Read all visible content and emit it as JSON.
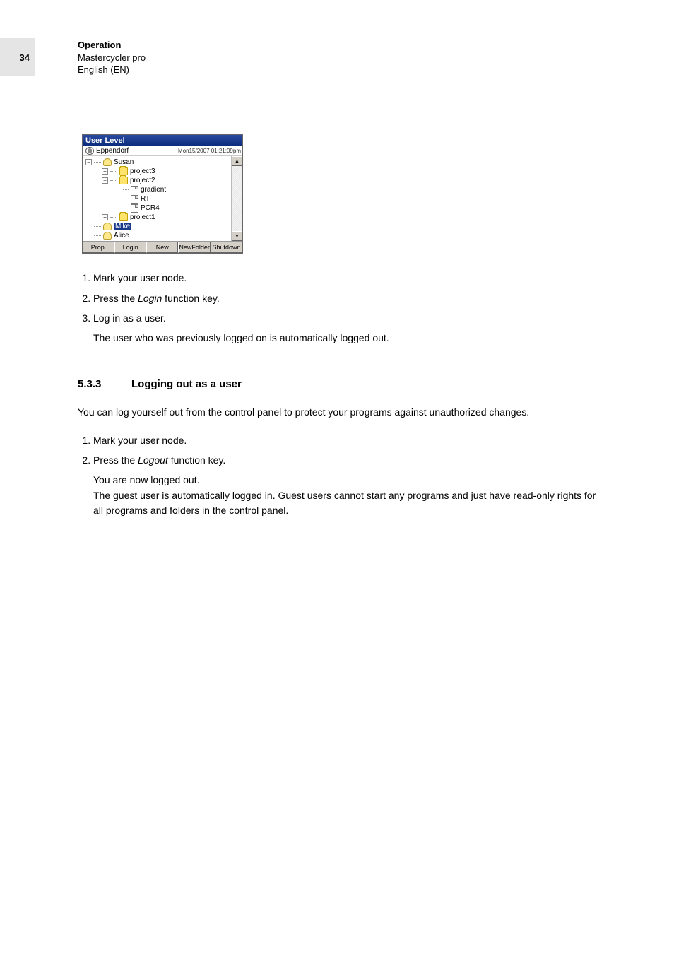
{
  "page_number": "34",
  "header": {
    "line1": "Operation",
    "line2": "Mastercycler pro",
    "line3": "English (EN)"
  },
  "screenshot": {
    "title": "User Level",
    "root": "Eppendorf",
    "timestamp": "Mon15/2007 01:21:09pm",
    "tree": {
      "user1": "Susan",
      "folder1": "project3",
      "folder2": "project2",
      "file1": "gradient",
      "file2": "RT",
      "file3": "PCR4",
      "folder3": "project1",
      "user2_selected": "Mike",
      "user3": "Alice"
    },
    "buttons": {
      "b1": "Prop.",
      "b2": "Login",
      "b3": "New",
      "b4": "NewFolder",
      "b5": "Shutdown"
    },
    "scroll_up": "▲",
    "scroll_down": "▼"
  },
  "steps_a": {
    "s1": "Mark your user node.",
    "s2_pre": "Press the ",
    "s2_key": "Login",
    "s2_post": " function key.",
    "s3": "Log in as a user.",
    "s3_note": "The user who was previously logged on is automatically logged out."
  },
  "section": {
    "num": "5.3.3",
    "title": "Logging out as a user"
  },
  "intro_b": "You can log yourself out from the control panel to protect your programs against unauthorized changes.",
  "steps_b": {
    "s1": "Mark your user node.",
    "s2_pre": "Press the ",
    "s2_key": "Logout",
    "s2_post": " function key.",
    "note1": "You are now logged out.",
    "note2": "The guest user  is automatically logged in. Guest users cannot start any programs and just have read-only rights for all programs and folders in the control panel."
  }
}
